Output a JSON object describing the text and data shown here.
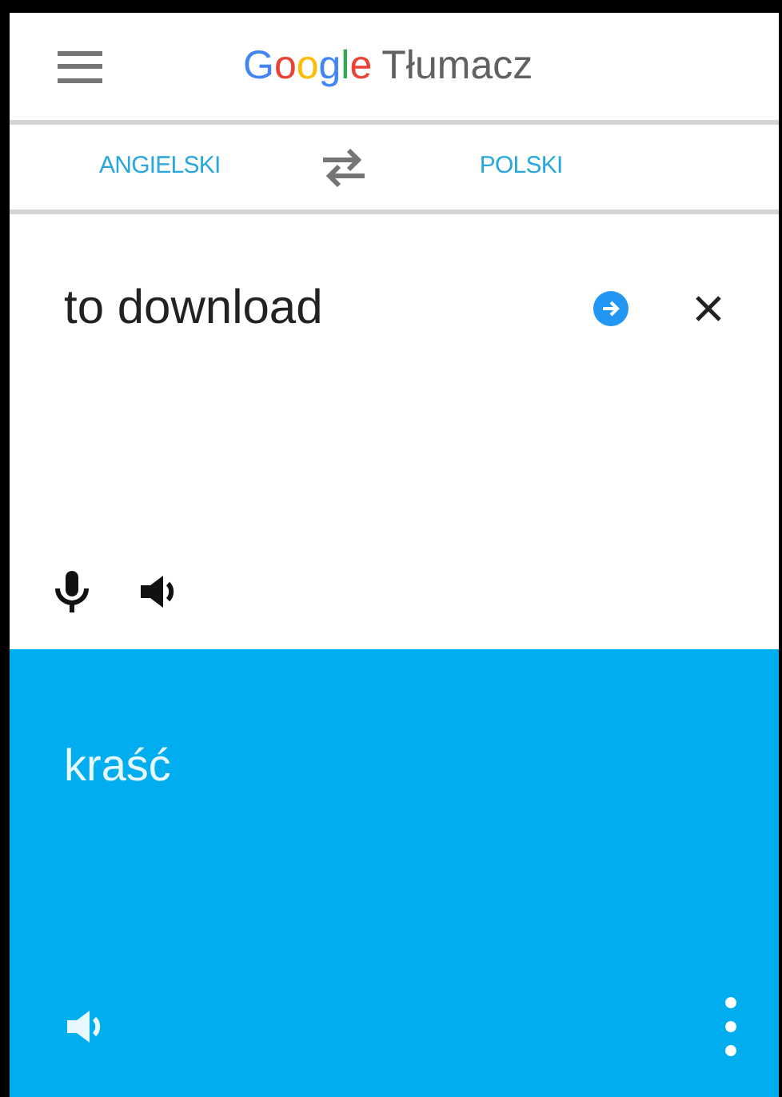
{
  "app_bar": {
    "logo": "Google",
    "title": "Tłumacz"
  },
  "languages": {
    "source": "ANGIELSKI",
    "target": "POLSKI"
  },
  "input": {
    "value": "to download"
  },
  "translation": {
    "text": "kraść"
  }
}
